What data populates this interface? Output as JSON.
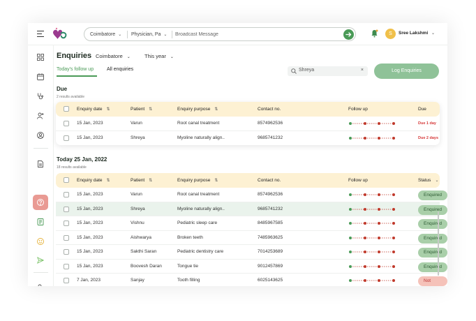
{
  "topbar": {
    "location_select": "Coimbatore",
    "doctor_select": "Physician, Pa",
    "broadcast_placeholder": "Broadcast Message",
    "user_initial": "S",
    "user_name": "Sree Lakshmi"
  },
  "page": {
    "title": "Enquiries",
    "location_filter": "Coimbatore",
    "period_filter": "This year",
    "tabs": [
      "Today's follow up",
      "All enquiries"
    ],
    "search_value": "Shreya",
    "log_button": "Log Enquiries"
  },
  "due": {
    "title": "Due",
    "count_text": "2 results available",
    "headers": [
      "Enquiry date",
      "Patient",
      "Enquiry purpose",
      "Contact no.",
      "Follow up",
      "Due"
    ],
    "rows": [
      {
        "date": "15 Jan, 2023",
        "patient": "Varun",
        "purpose": "Root canal treatment",
        "contact": "8574962536",
        "due": "Due 1 day"
      },
      {
        "date": "15 Jan, 2023",
        "patient": "Shreya",
        "purpose": "Myoline naturally align..",
        "contact": "9685741232",
        "due": "Due 2 days"
      }
    ]
  },
  "today": {
    "title": "Today 25 Jan, 2022",
    "count_text": "18 results available",
    "headers": [
      "Enquiry date",
      "Patient",
      "Enquiry purpose",
      "Contact no.",
      "Follow up",
      "Status"
    ],
    "rows": [
      {
        "date": "15 Jan, 2023",
        "patient": "Varun",
        "purpose": "Root canal treatment",
        "contact": "8574962536",
        "status": "Enquired"
      },
      {
        "date": "15 Jan, 2023",
        "patient": "Shreya",
        "purpose": "Myoline naturally align..",
        "contact": "9685741232",
        "status": "Enquired"
      },
      {
        "date": "15 Jan, 2023",
        "patient": "Vishnu",
        "purpose": "Pediatric sleep care",
        "contact": "8485967585",
        "status": "Enquired"
      },
      {
        "date": "15 Jan, 2023",
        "patient": "Aishwarya",
        "purpose": "Broken teeth",
        "contact": "7485963625",
        "status": "Enquired"
      },
      {
        "date": "15 Jan, 2023",
        "patient": "Sakthi Saran",
        "purpose": "Pediatric dentistry care",
        "contact": "7014253689",
        "status": "Enquired"
      },
      {
        "date": "15 Jan, 2023",
        "patient": "Boovesh Daran",
        "purpose": "Tongue tie",
        "contact": "9012457869",
        "status": "Enquired"
      },
      {
        "date": "7 Jan, 2023",
        "patient": "Sanjay",
        "purpose": "Tooth filling",
        "contact": "6025143625",
        "status": "Not Enquired"
      }
    ]
  },
  "colors": {
    "brand_green": "#4a9a57",
    "header_yellow": "#fdf1d3",
    "due_red": "#d63a3a",
    "followup_red": "#c0392b"
  }
}
